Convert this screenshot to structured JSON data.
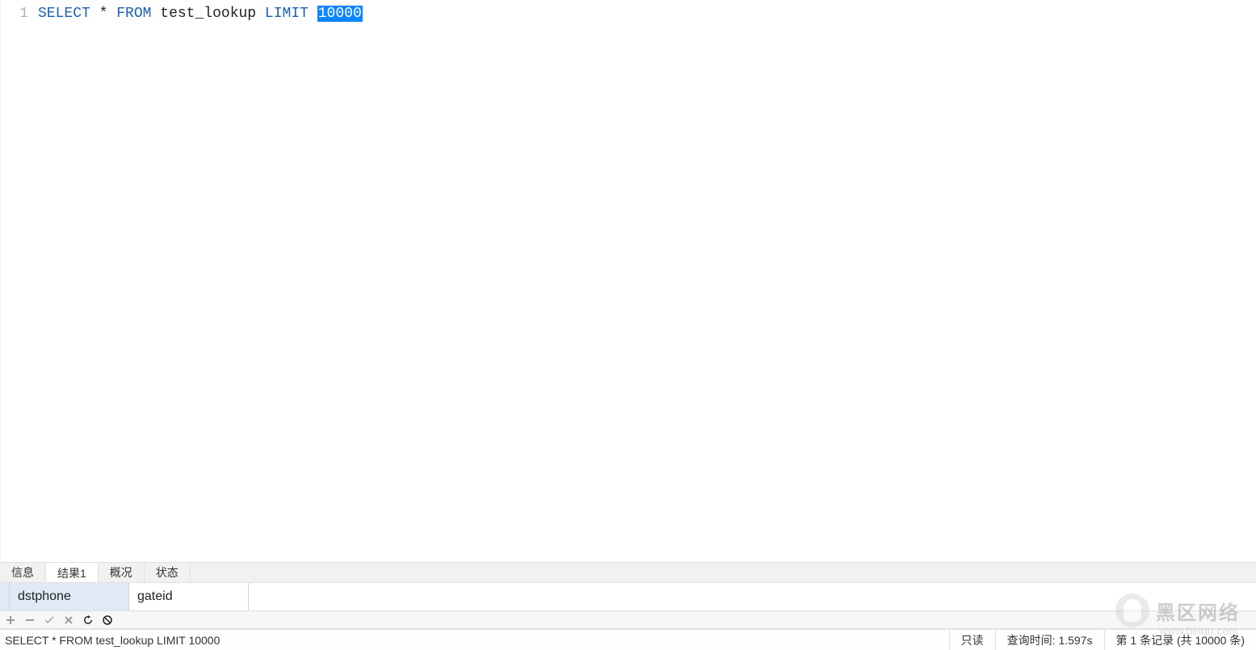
{
  "editor": {
    "line_number": "1",
    "sql": {
      "kw_select": "SELECT",
      "star": "*",
      "kw_from": "FROM",
      "table": "test_lookup",
      "kw_limit": "LIMIT",
      "limit_value": "10000"
    }
  },
  "tabs": [
    {
      "label": "信息",
      "active": false
    },
    {
      "label": "结果1",
      "active": true
    },
    {
      "label": "概况",
      "active": false
    },
    {
      "label": "状态",
      "active": false
    }
  ],
  "results": {
    "columns": [
      "dstphone",
      "gateid"
    ]
  },
  "toolbar_icons": [
    "plus",
    "minus",
    "check",
    "x",
    "refresh",
    "stop"
  ],
  "status": {
    "query_text": "SELECT * FROM test_lookup LIMIT 10000",
    "readonly": "只读",
    "query_time": "查询时间: 1.597s",
    "record_info": "第 1 条记录 (共 10000 条)"
  },
  "watermark": {
    "text": "黑区网络",
    "sub": "www.heiqu.com"
  }
}
